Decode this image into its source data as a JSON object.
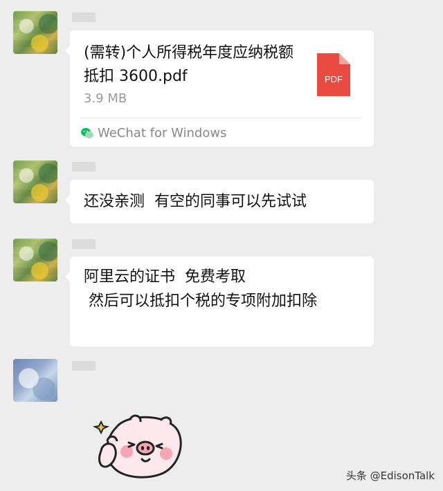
{
  "messages": {
    "file": {
      "title": "(需转)个人所得税年度应纳税额抵扣 3600.pdf",
      "size": "3.9 MB",
      "file_type_label": "PDF",
      "source": "WeChat for Windows"
    },
    "text1": "还没亲测  有空的同事可以先试试",
    "text2": "阿里云的证书  免费考取\n 然后可以抵扣个税的专项附加扣除"
  },
  "sticker": {
    "description": "pig-thumbs-up-sticker"
  },
  "watermark": "头条 @EdisonTalk",
  "colors": {
    "chat_background": "#ededed",
    "bubble_background": "#ffffff",
    "pdf_red": "#e94b41",
    "wechat_green": "#07c160"
  }
}
